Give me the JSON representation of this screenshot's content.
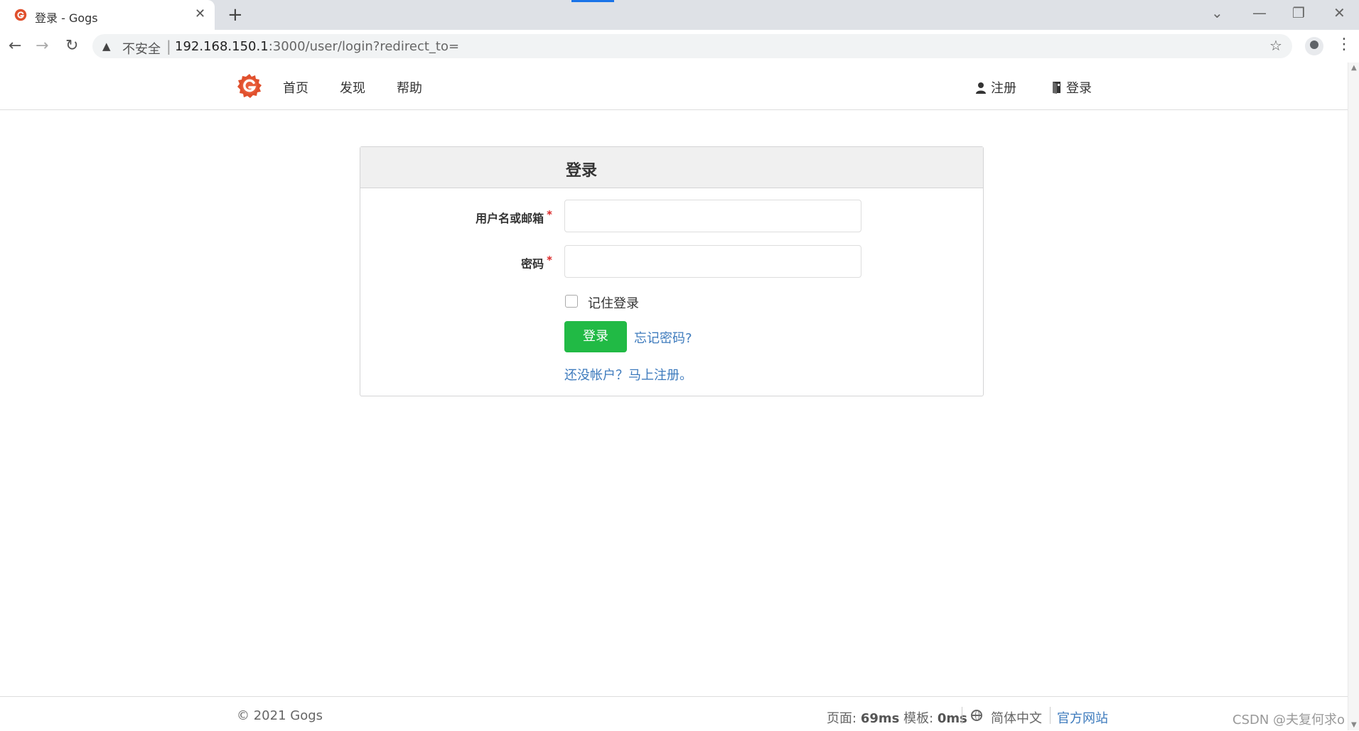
{
  "browser": {
    "tab_title": "登录 - Gogs",
    "close_glyph": "✕",
    "new_tab_glyph": "+",
    "not_secure": "不安全",
    "separator": "|",
    "url_host": "192.168.150.1",
    "url_path": ":3000/user/login?redirect_to=",
    "icons": [
      "back-icon",
      "forward-icon",
      "reload-icon",
      "warning-icon",
      "star-icon",
      "profile-icon",
      "menu-icon"
    ]
  },
  "header": {
    "nav": [
      "首页",
      "发现",
      "帮助"
    ],
    "register": "注册",
    "login": "登录"
  },
  "login_form": {
    "title": "登录",
    "username_label": "用户名或邮箱",
    "password_label": "密码",
    "required_mark": "*",
    "username_value": "",
    "password_value": "",
    "remember_label": "记住登录",
    "remember_checked": false,
    "submit_label": "登录",
    "forgot_link": "忘记密码?",
    "signup_link": "还没帐户？马上注册。"
  },
  "footer": {
    "copyright": "© 2021 Gogs",
    "page_label": "页面:",
    "page_time": "69ms",
    "template_label": "模板:",
    "template_time": "0ms",
    "language": "简体中文",
    "official_site": "官方网站",
    "watermark": "CSDN @夫复何求o"
  },
  "colors": {
    "primary_button": "#21ba45",
    "link": "#3e7bbd",
    "required": "#db2828",
    "logo": "#e0502d"
  }
}
